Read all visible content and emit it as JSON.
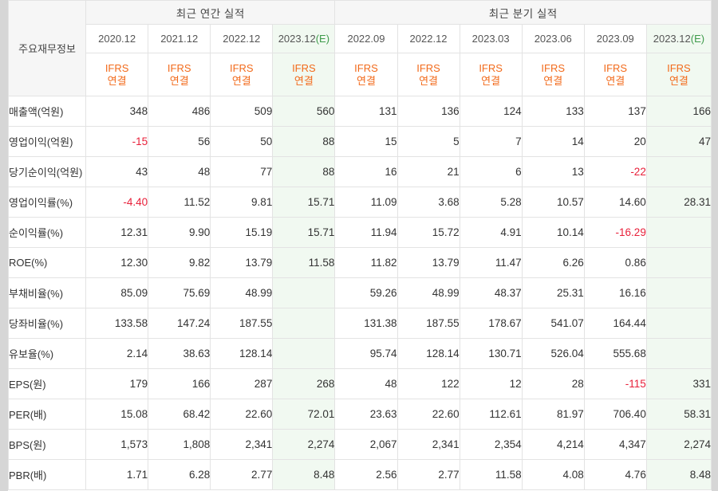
{
  "header": {
    "label_head": "주요재무정보",
    "annual_group": "최근 연간 실적",
    "quarter_group": "최근 분기 실적"
  },
  "periods": [
    {
      "label": "2020.12",
      "est": ""
    },
    {
      "label": "2021.12",
      "est": ""
    },
    {
      "label": "2022.12",
      "est": ""
    },
    {
      "label": "2023.12",
      "est": "(E)"
    },
    {
      "label": "2022.09",
      "est": ""
    },
    {
      "label": "2022.12",
      "est": ""
    },
    {
      "label": "2023.03",
      "est": ""
    },
    {
      "label": "2023.06",
      "est": ""
    },
    {
      "label": "2023.09",
      "est": ""
    },
    {
      "label": "2023.12",
      "est": "(E)"
    }
  ],
  "ifrs": {
    "line1": "IFRS",
    "line2": "연결"
  },
  "colors": {
    "negative": "#e8203a",
    "ifrs": "#f26a1b",
    "estimate_bg": "#f1f9f1"
  },
  "rows": [
    {
      "label": "매출액(억원)",
      "values": [
        "348",
        "486",
        "509",
        "560",
        "131",
        "136",
        "124",
        "133",
        "137",
        "166"
      ]
    },
    {
      "label": "영업이익(억원)",
      "values": [
        "-15",
        "56",
        "50",
        "88",
        "15",
        "5",
        "7",
        "14",
        "20",
        "47"
      ]
    },
    {
      "label": "당기순이익(억원)",
      "values": [
        "43",
        "48",
        "77",
        "88",
        "16",
        "21",
        "6",
        "13",
        "-22",
        ""
      ]
    },
    {
      "label": "영업이익률(%)",
      "values": [
        "-4.40",
        "11.52",
        "9.81",
        "15.71",
        "11.09",
        "3.68",
        "5.28",
        "10.57",
        "14.60",
        "28.31"
      ]
    },
    {
      "label": "순이익률(%)",
      "values": [
        "12.31",
        "9.90",
        "15.19",
        "15.71",
        "11.94",
        "15.72",
        "4.91",
        "10.14",
        "-16.29",
        ""
      ]
    },
    {
      "label": "ROE(%)",
      "values": [
        "12.30",
        "9.82",
        "13.79",
        "11.58",
        "11.82",
        "13.79",
        "11.47",
        "6.26",
        "0.86",
        ""
      ]
    },
    {
      "label": "부채비율(%)",
      "values": [
        "85.09",
        "75.69",
        "48.99",
        "",
        "59.26",
        "48.99",
        "48.37",
        "25.31",
        "16.16",
        ""
      ]
    },
    {
      "label": "당좌비율(%)",
      "values": [
        "133.58",
        "147.24",
        "187.55",
        "",
        "131.38",
        "187.55",
        "178.67",
        "541.07",
        "164.44",
        ""
      ]
    },
    {
      "label": "유보율(%)",
      "values": [
        "2.14",
        "38.63",
        "128.14",
        "",
        "95.74",
        "128.14",
        "130.71",
        "526.04",
        "555.68",
        ""
      ]
    },
    {
      "label": "EPS(원)",
      "values": [
        "179",
        "166",
        "287",
        "268",
        "48",
        "122",
        "12",
        "28",
        "-115",
        "331"
      ]
    },
    {
      "label": "PER(배)",
      "values": [
        "15.08",
        "68.42",
        "22.60",
        "72.01",
        "23.63",
        "22.60",
        "112.61",
        "81.97",
        "706.40",
        "58.31"
      ]
    },
    {
      "label": "BPS(원)",
      "values": [
        "1,573",
        "1,808",
        "2,341",
        "2,274",
        "2,067",
        "2,341",
        "2,354",
        "4,214",
        "4,347",
        "2,274"
      ]
    },
    {
      "label": "PBR(배)",
      "values": [
        "1.71",
        "6.28",
        "2.77",
        "8.48",
        "2.56",
        "2.77",
        "11.58",
        "4.08",
        "4.76",
        "8.48"
      ]
    }
  ]
}
